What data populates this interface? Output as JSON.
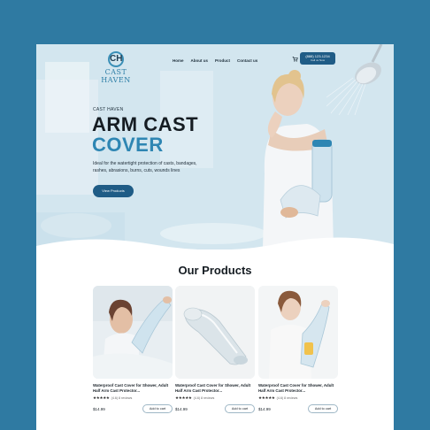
{
  "brand": {
    "name": "CAST HAVEN",
    "logo_letters": "CH"
  },
  "nav": {
    "items": [
      "Home",
      "About us",
      "Product",
      "Contact us"
    ]
  },
  "header": {
    "phone": "(888) 123-1234",
    "phone_sub": "Call us Now"
  },
  "hero": {
    "eyebrow": "CAST HAVEN",
    "title_line1": "ARM CAST",
    "title_line2": "COVER",
    "description": "Ideal for the watertight protection of casts, bandages, rashes, abrasions, burns, cuts, wounds lines",
    "button": "View Products"
  },
  "products": {
    "heading": "Our Products",
    "items": [
      {
        "title": "Waterproof Cast Cover for Shower, Adult Half Arm Cast Protector...",
        "stars": "★★★★★",
        "reviews": "(4.6)  8 reviews",
        "price": "$14.99",
        "button": "Add to cart"
      },
      {
        "title": "Waterproof Cast Cover for Shower, Adult Half Arm Cast Protector...",
        "stars": "★★★★★",
        "reviews": "(4.6)  8 reviews",
        "price": "$14.99",
        "button": "Add to cart"
      },
      {
        "title": "Waterproof Cast Cover for Shower, Adult Half Arm Cast Protector...",
        "stars": "★★★★★",
        "reviews": "(4.6)  8 reviews",
        "price": "$14.99",
        "button": "Add to cart"
      }
    ]
  },
  "colors": {
    "frame": "#2f7aa2",
    "accent": "#2e86b3",
    "button": "#1f5c86"
  }
}
